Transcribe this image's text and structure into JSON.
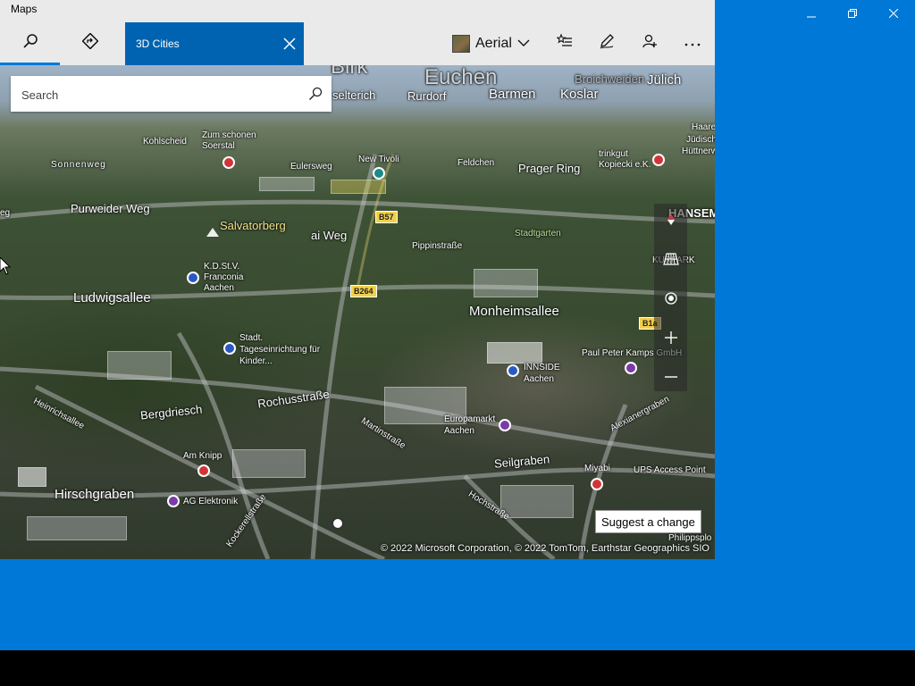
{
  "window": {
    "title": "Maps"
  },
  "toolbar": {
    "search_tab_icon": "search-icon",
    "directions_tab_icon": "directions-icon",
    "active_tab": {
      "label": "3D Cities",
      "close_icon": "close-icon"
    },
    "map_style": {
      "label": "Aerial",
      "thumbnail_icon": "aerial-thumbnail-icon",
      "chevron_icon": "chevron-down-icon"
    },
    "favorites_icon": "favorites-icon",
    "ink_icon": "ink-pen-icon",
    "account_icon": "add-person-icon",
    "more_icon": "more-icon"
  },
  "search": {
    "placeholder": "Search",
    "value": ""
  },
  "map_labels": {
    "birk": "Birk",
    "euchen": "Euchen",
    "barmen": "Barmen",
    "koslar": "Koslar",
    "broichweiden": "Broichweiden",
    "julich": "Jülich",
    "selterich": "selterich",
    "rurdorf": "Rurdorf",
    "kohlscheid": "Kohlscheid",
    "zum_schonen_soerstal": "Zum schonen\nSoerstal",
    "sonnenweg": "Sonnenweg",
    "eulersweg": "Eulersweg",
    "new_tivoli": "New Tivoli",
    "feldchen": "Feldchen",
    "prager_ring": "Prager Ring",
    "trinkgut": "trinkgut\nKopiecki e.K.",
    "haaren": "Haare",
    "judisch": "Jüdisch",
    "kuttnerweg": "Hüttnerweg",
    "eg": "eg",
    "purweider_weg": "Purweider Weg",
    "salvatorberg": "Salvatorberg",
    "ai_weg": "ai Weg",
    "b57": "B57",
    "pippinstrasse": "Pippinstraße",
    "stadtgarten": "Stadtgarten",
    "hansemann": "HANSEM",
    "kurpark": "KURPARK",
    "kdstv": "K.D.St.V.\nFranconia\nAachen",
    "ludwigsallee": "Ludwigsallee",
    "b264": "B264",
    "monheimsallee": "Monheimsallee",
    "b1a": "B1a",
    "stadt_tages": "Stadt.\nTageseinrichtung für\nKinder...",
    "paul_peter": "Paul Peter Kamps GmbH",
    "inside_aachen": "INNSIDE\nAachen",
    "heinrichsallee": "Heinrichsallee",
    "bergdriesch": "Bergdriesch",
    "rochusstrasse": "Rochusstraße",
    "martinstrasse": "Martinstraße",
    "europamarkt": "Europamarkt\nAachen",
    "alexianer": "Alexianergraben",
    "am_knipp": "Am Knipp",
    "seilgraben": "Seilgraben",
    "miyabi": "Miyabi",
    "ups": "UPS Access Point",
    "hirschgraben": "Hirschgraben",
    "ag_elektronik": "AG Elektronik",
    "hochstrasse": "Hochstraße",
    "philipps": "Philippsplo",
    "kockerellstrasse": "Kockerellstraße"
  },
  "map_controls": {
    "compass_icon": "compass-icon",
    "tilt_icon": "3d-tilt-icon",
    "locate_icon": "locate-me-icon",
    "zoom_in_icon": "zoom-in-icon",
    "zoom_out_icon": "zoom-out-icon"
  },
  "suggest_change": "Suggest a change",
  "copyright": "© 2022 Microsoft Corporation, © 2022 TomTom, Earthstar Geographics  SIO",
  "caption_buttons": {
    "minimize_icon": "minimize-icon",
    "restore_icon": "restore-icon",
    "close_icon": "close-icon"
  }
}
